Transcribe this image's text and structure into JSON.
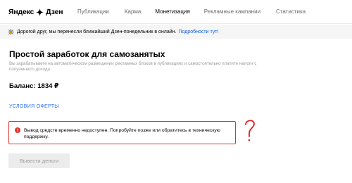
{
  "header": {
    "logo_part1": "Яндекс",
    "logo_part2": "Дзен",
    "nav": [
      {
        "label": "Публикации",
        "active": false
      },
      {
        "label": "Карма",
        "active": false
      },
      {
        "label": "Монетизация",
        "active": true
      },
      {
        "label": "Рекламные кампании",
        "active": false
      },
      {
        "label": "Статистика",
        "active": false
      }
    ]
  },
  "banner": {
    "icon": "sun-icon",
    "text": "Дорогой друг, мы перенесли ближайший Дзен-понедельник в онлайн.",
    "link": "Подробности тут!"
  },
  "main": {
    "title": "Простой заработок для самозанятых",
    "description": "Вы зарабатываете на автоматическом размещении рекламных блоков в публикациях и самостоятельно платите налоги с полученного дохода.",
    "balance": "Баланс: 1834 ₽",
    "terms_link": "УСЛОВИЯ ОФЕРТЫ",
    "error": {
      "icon": "error-icon",
      "text": "Вывод средств временно недоступен. Попробуйте позже или обратитесь в техническую поддержку."
    },
    "withdraw_button": "Вывести деньги"
  },
  "colors": {
    "error_red": "#e2342b",
    "link_blue": "#2a73e8",
    "banner_bg": "#f5f5f5",
    "disabled_button_bg": "#ececec"
  }
}
